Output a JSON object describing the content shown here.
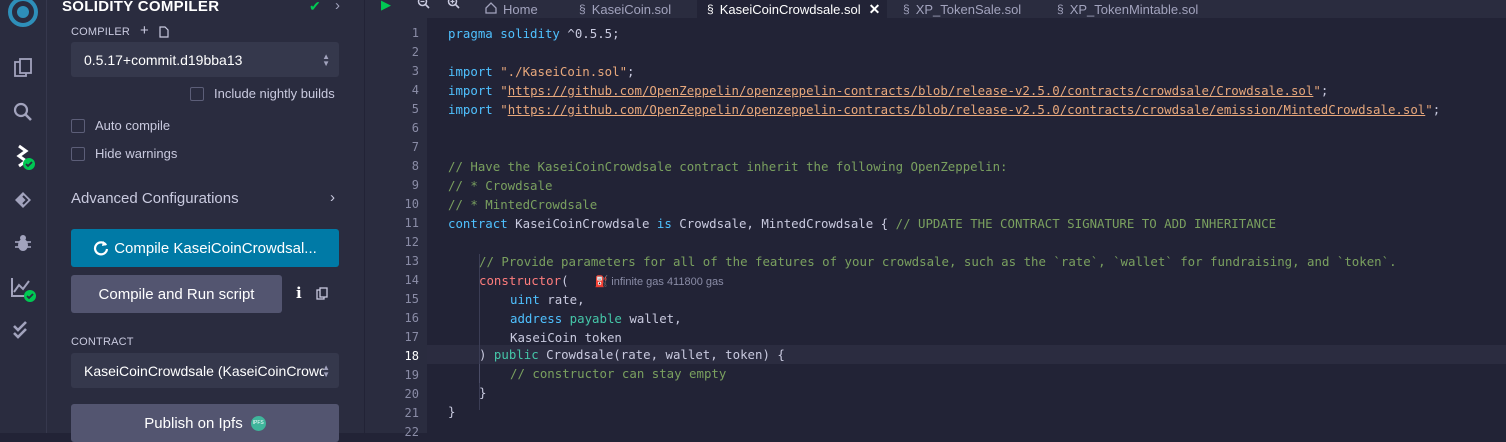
{
  "panel": {
    "title": "SOLIDITY COMPILER",
    "compiler_label": "COMPILER",
    "compiler_version": "0.5.17+commit.d19bba13",
    "nightly_label": "Include nightly builds",
    "auto_compile_label": "Auto compile",
    "hide_warnings_label": "Hide warnings",
    "advanced_label": "Advanced Configurations",
    "compile_button": "Compile KaseiCoinCrowdsal...",
    "compile_run_button": "Compile and Run script",
    "contract_label": "CONTRACT",
    "contract_selected": "KaseiCoinCrowdsale (KaseiCoinCrowdsale.sol)",
    "publish_button": "Publish on Ipfs",
    "ipfs_badge": "IPFS"
  },
  "tabs": [
    {
      "label": "Home",
      "icon": "home-icon"
    },
    {
      "label": "KaseiCoin.sol",
      "icon": "solidity-file-icon"
    },
    {
      "label": "KaseiCoinCrowdsale.sol",
      "icon": "solidity-file-icon",
      "active": true
    },
    {
      "label": "XP_TokenSale.sol",
      "icon": "solidity-file-icon"
    },
    {
      "label": "XP_TokenMintable.sol",
      "icon": "solidity-file-icon"
    }
  ],
  "editor": {
    "current_line": 18,
    "lines": [
      "1",
      "2",
      "3",
      "4",
      "5",
      "6",
      "7",
      "8",
      "9",
      "10",
      "11",
      "12",
      "13",
      "14",
      "15",
      "16",
      "17",
      "18",
      "19",
      "20",
      "21",
      "22"
    ],
    "code": {
      "l1a": "pragma solidity",
      "l1b": " ^0.5.5;",
      "l3a": "import ",
      "l3b": "\"./KaseiCoin.sol\"",
      "l3c": ";",
      "l4a": "import ",
      "l4q1": "\"",
      "l4url": "https://github.com/OpenZeppelin/openzeppelin-contracts/blob/release-v2.5.0/contracts/crowdsale/Crowdsale.sol",
      "l4q2": "\"",
      "l4c": ";",
      "l5a": "import ",
      "l5q1": "\"",
      "l5url": "https://github.com/OpenZeppelin/openzeppelin-contracts/blob/release-v2.5.0/contracts/crowdsale/emission/MintedCrowdsale.sol",
      "l5q2": "\"",
      "l5c": ";",
      "l8": "// Have the KaseiCoinCrowdsale contract inherit the following OpenZeppelin:",
      "l9": "// * Crowdsale",
      "l10": "// * MintedCrowdsale",
      "l11a": "contract",
      "l11b": " KaseiCoinCrowdsale ",
      "l11c": "is",
      "l11d": " Crowdsale, MintedCrowdsale { ",
      "l11e": "// UPDATE THE CONTRACT SIGNATURE TO ADD INHERITANCE",
      "l13": "// Provide parameters for all of the features of your crowdsale, such as the `rate`, `wallet` for fundraising, and `token`.",
      "l14a": "constructor",
      "l14b": "(",
      "l14gas": "infinite gas 411800 gas",
      "l15a": "uint",
      "l15b": " rate,",
      "l16a": "address",
      "l16b": " payable",
      "l16c": " wallet,",
      "l17": "KaseiCoin token",
      "l18a": ") ",
      "l18b": "public",
      "l18c": " Crowdsale(rate, wallet, token) {",
      "l19": "// constructor can stay empty",
      "l20": "}",
      "l21": "}"
    }
  },
  "colors": {
    "accent": "#007aa6",
    "success": "#00c853",
    "background": "#222336",
    "panel": "#2a2c3f"
  }
}
